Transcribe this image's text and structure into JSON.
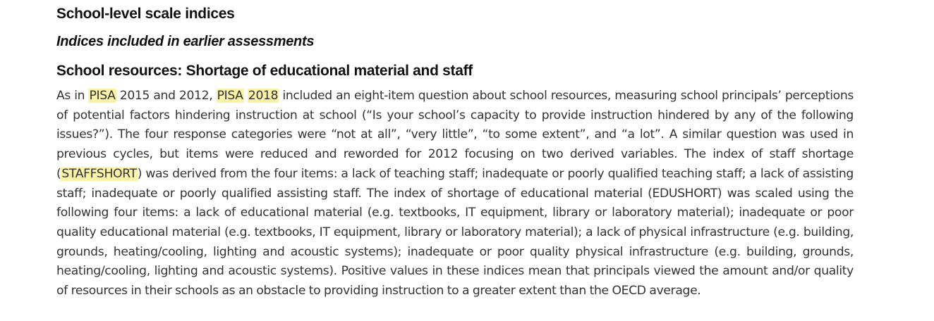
{
  "headings": {
    "section": "School-level scale indices",
    "subsection": "Indices included in earlier assessments",
    "topic": "School resources: Shortage of educational material and staff"
  },
  "body": {
    "t1": "As in ",
    "h1": "PISA",
    "t2": " 2015 and 2012, ",
    "h2": "PISA",
    "t3": " ",
    "h3": "2018",
    "t4": " included an eight-item question about school resources, measuring school principals’ perceptions of potential factors hindering instruction at school (“Is your school’s capacity to provide instruction hindered by any of the following issues?”). The four response categories were “not at all”, “very little”, “to some extent”, and “a lot”. A similar question was used in previous cycles, but items were reduced and reworded for 2012 focusing on two derived variables. The index of staff shortage (",
    "h4": "STAFFSHORT",
    "t5": ") was derived from the four items: a lack of teaching staff; inadequate or poorly qualified teaching staff; a lack of assisting staff; inadequate or poorly qualified assisting staff. The index of shortage of educational material (EDUSHORT) was scaled using the following four items: a lack of educational material (e.g. textbooks, IT equipment, library or laboratory material); inadequate or poor quality educational material (e.g. textbooks, IT equipment, library or laboratory material); a lack of physical infrastructure (e.g. building, grounds, heating/cooling, lighting and acoustic systems); inadequate or poor quality physical infrastructure (e.g. building, grounds, heating/cooling, lighting and acoustic systems). Positive values in these indices mean that principals viewed the amount and/or quality of resources in their schools as an obstacle to providing instruction to a greater extent than the OECD average."
  },
  "colors": {
    "highlight": "#fbf3a9",
    "text": "#333333",
    "heading": "#111111"
  }
}
